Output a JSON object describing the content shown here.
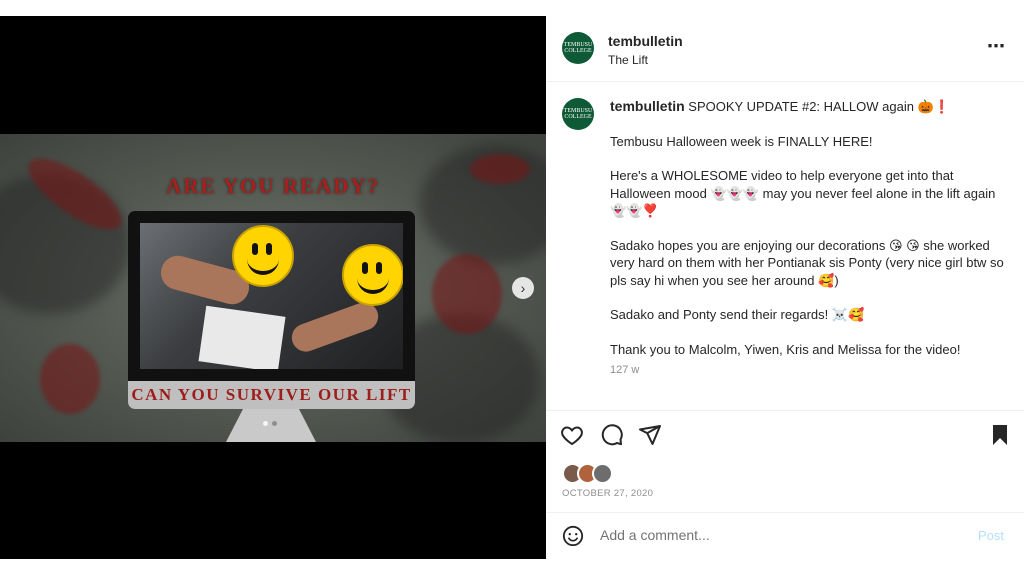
{
  "post": {
    "username": "tembulletin",
    "location": "The Lift",
    "avatar_text": "TEMBUSU COLLEGE",
    "more_icon": "⋯",
    "caption": {
      "username": "tembulletin",
      "paragraphs": [
        "SPOOKY UPDATE #2: HALLOW again 🎃❗",
        "Tembusu Halloween week is FINALLY HERE!",
        "Here's a WHOLESOME video to help everyone get into that Halloween mood 👻👻👻 may you never feel alone in the lift again 👻👻❣️",
        "Sadako hopes you are enjoying our decorations 😘 😘 she worked very hard on them with her Pontianak sis Ponty (very nice girl btw so pls say hi when you see her around 🥰)",
        "Sadako and Ponty send their regards! ☠️🥰",
        "Thank you to Malcolm, Yiwen, Kris and Melissa for the video!"
      ],
      "time": "127 w"
    },
    "date": "OCTOBER 27, 2020",
    "comment_placeholder": "Add a comment...",
    "post_label": "Post"
  },
  "media": {
    "headline": "ARE YOU READY?",
    "footer": "CAN YOU SURVIVE OUR LIFT",
    "next_icon": "›",
    "slides": 2,
    "active_slide": 1
  },
  "icons": {
    "like": "heart-icon",
    "comment": "comment-icon",
    "share": "share-icon",
    "save": "bookmark-icon",
    "emoji": "emoji-icon"
  },
  "colors": {
    "avatar_bg": "#0f5a36",
    "headline": "#a8201d",
    "post_button": "#b2dffc"
  }
}
